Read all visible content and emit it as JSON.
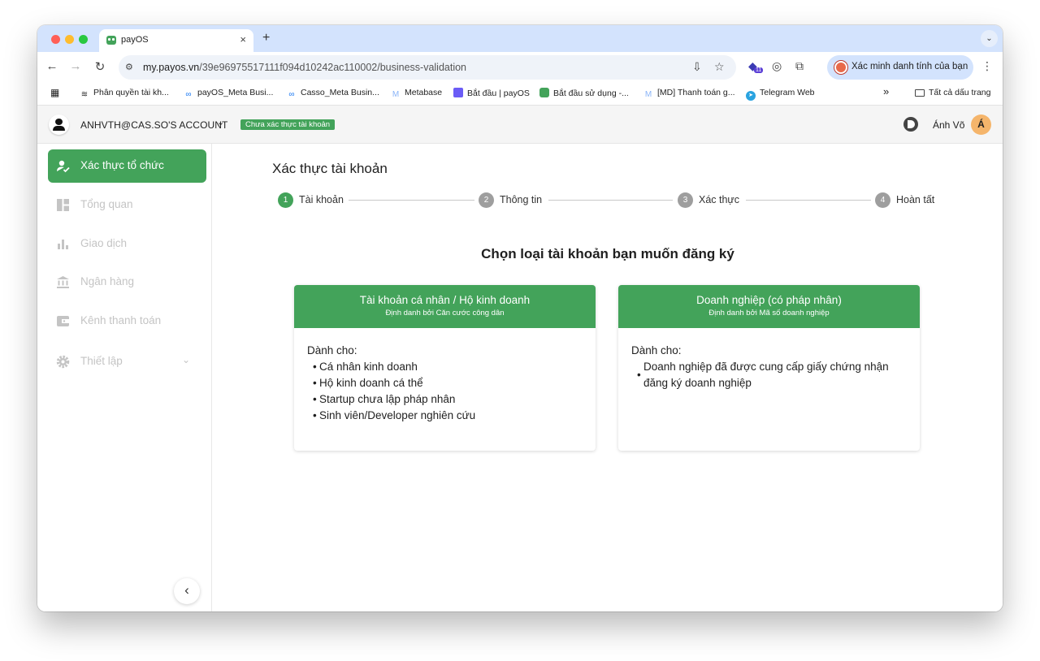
{
  "browser": {
    "tab": {
      "title": "payOS",
      "close": "×"
    },
    "new_tab": "+",
    "url_host": "my.payos.vn",
    "url_path": "/39e96975517111f094d10242ac110002/business-validation",
    "ext_badge": "11",
    "profile_label": "Xác minh danh tính của bạn"
  },
  "bookmarks": [
    {
      "label": "Phân quyền tài kh...",
      "icon": "layers-icon"
    },
    {
      "label": "payOS_Meta Busi...",
      "icon": "meta-icon"
    },
    {
      "label": "Casso_Meta Busin...",
      "icon": "meta-icon"
    },
    {
      "label": "Metabase",
      "icon": "gmail-icon"
    },
    {
      "label": "Bắt đầu | payOS",
      "icon": "square-icon"
    },
    {
      "label": "Bắt đầu sử dụng -...",
      "icon": "payos-icon"
    },
    {
      "label": "[MD] Thanh toán g...",
      "icon": "gmail-icon"
    },
    {
      "label": "Telegram Web",
      "icon": "telegram-icon"
    }
  ],
  "bookmarks_more": "»",
  "all_bookmarks": "Tất cả dấu trang",
  "header": {
    "account_name": "ANHVTH@CAS.SO'S ACCOUNT",
    "status_badge": "Chưa xác thực tài khoản",
    "user_name": "Ánh Võ",
    "user_initial": "Á"
  },
  "sidebar": {
    "items": [
      {
        "label": "Xác thực tổ chức",
        "icon": "verify-user-icon",
        "active": true
      },
      {
        "label": "Tổng quan",
        "icon": "dashboard-icon",
        "active": false
      },
      {
        "label": "Giao dịch",
        "icon": "bar-chart-icon",
        "active": false
      },
      {
        "label": "Ngân hàng",
        "icon": "bank-icon",
        "active": false
      },
      {
        "label": "Kênh thanh toán",
        "icon": "wallet-icon",
        "active": false
      },
      {
        "label": "Thiết lập",
        "icon": "gear-icon",
        "active": false
      }
    ]
  },
  "main": {
    "page_title": "Xác thực tài khoản",
    "steps": [
      {
        "num": "1",
        "label": "Tài khoản",
        "active": true
      },
      {
        "num": "2",
        "label": "Thông tin",
        "active": false
      },
      {
        "num": "3",
        "label": "Xác thực",
        "active": false
      },
      {
        "num": "4",
        "label": "Hoàn tất",
        "active": false
      }
    ],
    "section_title": "Chọn loại tài khoản bạn muốn đăng ký",
    "cards": [
      {
        "title": "Tài khoản cá nhân / Hộ kinh doanh",
        "subtitle": "Định danh bởi Căn cước công dân",
        "for_label": "Dành cho:",
        "items": [
          "Cá nhân kinh doanh",
          "Hộ kinh doanh cá thể",
          "Startup chưa lập pháp nhân",
          "Sinh viên/Developer nghiên cứu"
        ]
      },
      {
        "title": "Doanh nghiệp (có pháp nhân)",
        "subtitle": "Định danh bởi Mã số doanh nghiệp",
        "for_label": "Dành cho:",
        "items": [
          "Doanh nghiệp đã được cung cấp giấy chứng nhận đăng ký doanh nghiệp"
        ]
      }
    ]
  },
  "colors": {
    "brand_green": "#43a35a",
    "tab_strip": "#d3e3fd"
  }
}
